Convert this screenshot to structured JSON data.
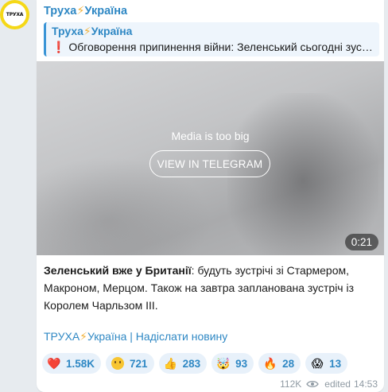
{
  "channel": {
    "name": "Труха",
    "name_suffix": "Україна",
    "avatar_text": "ТРУХА"
  },
  "reply": {
    "name": "Труха",
    "name_suffix": "Україна",
    "exclaim": "❗",
    "text": "Обговорення припинення війни: Зеленський сьогодні зус…"
  },
  "media": {
    "message": "Media is too big",
    "button_label": "VIEW IN TELEGRAM",
    "duration": "0:21"
  },
  "post": {
    "bold_lead": "Зеленський вже у Британії",
    "text": ": будуть зустрічі зі Стармером, Макроном, Мерцом. Також на завтра запланована зустріч із Королем Чарльзом ІІІ.",
    "link_main": "ТРУХА",
    "link_main_suffix": "Україна",
    "link_separator": "|",
    "link_submit": "Надіслати новину"
  },
  "reactions": [
    {
      "icon": "heart-icon",
      "emoji": "❤️",
      "count": "1.58K"
    },
    {
      "icon": "face-unamused-icon",
      "emoji": "",
      "count": "721"
    },
    {
      "icon": "thumbs-up-icon",
      "emoji": "👍",
      "count": "283"
    },
    {
      "icon": "mind-blown-icon",
      "emoji": "🤯",
      "count": "93"
    },
    {
      "icon": "fire-icon",
      "emoji": "🔥",
      "count": "28"
    },
    {
      "icon": "screaming-face-icon",
      "emoji": "😱",
      "count": "13"
    }
  ],
  "meta": {
    "views": "112K",
    "edited_label": "edited",
    "time": "14:53"
  },
  "colors": {
    "accent": "#2f88c4",
    "bolt": "#f2b33b",
    "background": "#e7ebef"
  }
}
